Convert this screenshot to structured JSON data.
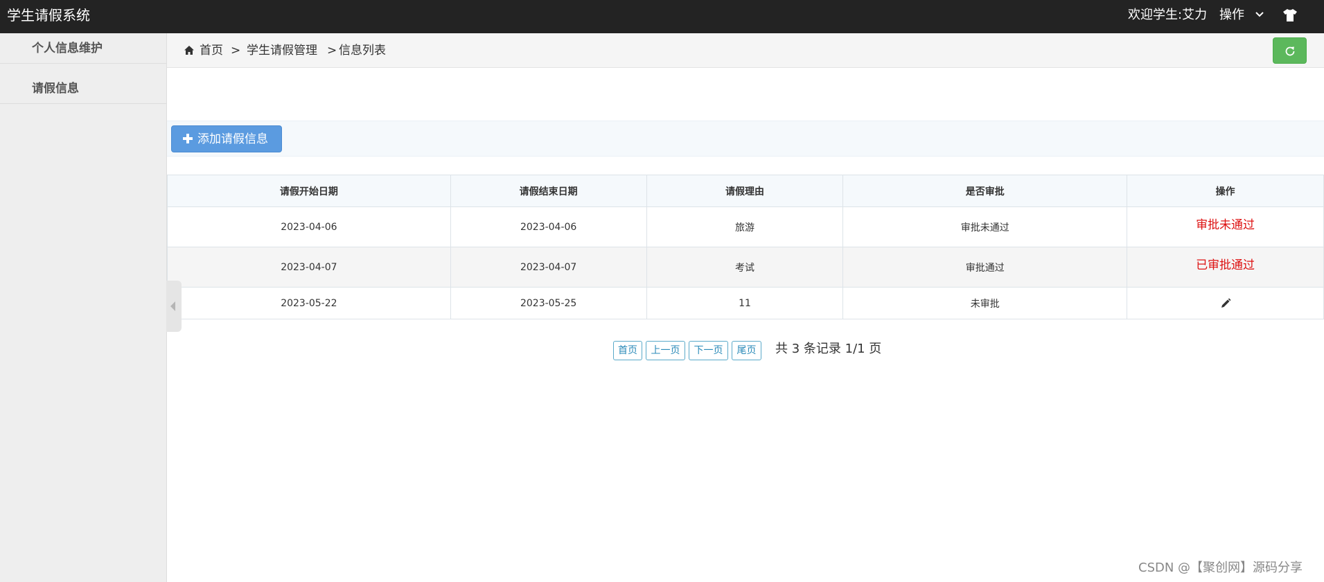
{
  "app": {
    "title": "学生请假系统"
  },
  "topbar": {
    "welcome": "欢迎学生:艾力",
    "operations_label": "操作",
    "dropdown_icon": "chevron-down-icon",
    "theme_icon": "tshirt-icon"
  },
  "sidebar": {
    "items": [
      {
        "label": "个人信息维护"
      },
      {
        "label": "请假信息"
      }
    ]
  },
  "breadcrumb": {
    "home_icon": "home-icon",
    "home": "首页",
    "sep1": ">",
    "section": "学生请假管理",
    "sep2": ">",
    "current": "信息列表"
  },
  "refresh": {
    "icon": "refresh-icon",
    "color": "#5cb85c"
  },
  "toolbar": {
    "add_label": "添加请假信息",
    "add_icon": "plus-icon",
    "add_color": "#5b9be0"
  },
  "table": {
    "columns": [
      "请假开始日期",
      "请假结束日期",
      "请假理由",
      "是否审批",
      "操作"
    ],
    "rows": [
      {
        "start": "2023-04-06",
        "end": "2023-04-06",
        "reason": "旅游",
        "approval": "审批未通过",
        "action": "审批未通过"
      },
      {
        "start": "2023-04-07",
        "end": "2023-04-07",
        "reason": "考试",
        "approval": "审批通过",
        "action": "已审批通过"
      },
      {
        "start": "2023-05-22",
        "end": "2023-05-25",
        "reason": "11",
        "approval": "未审批",
        "action_icon": "pencil-icon"
      }
    ],
    "status_color": "#dd1111"
  },
  "pagination": {
    "first": "首页",
    "prev": "上一页",
    "next": "下一页",
    "last": "尾页",
    "info": "共 3 条记录 1/1 页"
  },
  "watermark": "CSDN @【聚创网】源码分享"
}
